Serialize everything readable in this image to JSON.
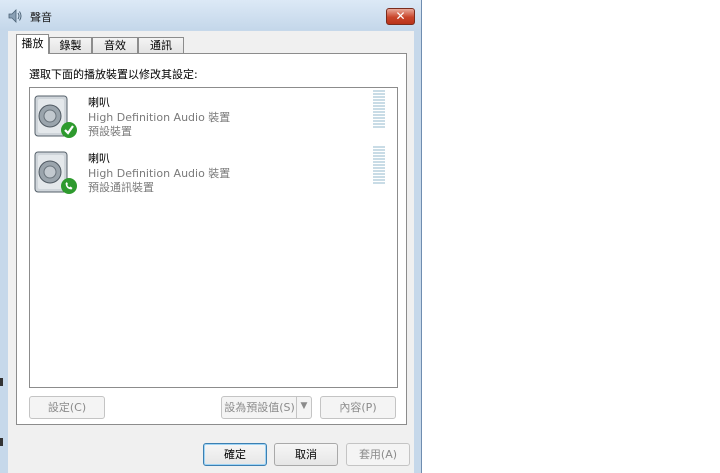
{
  "window": {
    "title": "聲音"
  },
  "tabs": [
    {
      "label": "播放",
      "active": true
    },
    {
      "label": "錄製",
      "active": false
    },
    {
      "label": "音效",
      "active": false
    },
    {
      "label": "通訊",
      "active": false
    }
  ],
  "panel": {
    "instruction": "選取下面的播放裝置以修改其設定:",
    "devices": [
      {
        "name": "喇叭",
        "description": "High Definition Audio 裝置",
        "status": "預設裝置",
        "badge_icon": "green-check-icon"
      },
      {
        "name": "喇叭",
        "description": "High Definition Audio 裝置",
        "status": "預設通訊裝置",
        "badge_icon": "green-phone-icon"
      }
    ],
    "configure_label": "設定(C)",
    "set_default_label": "設為預設值(S)",
    "properties_label": "內容(P)"
  },
  "footer": {
    "ok_label": "確定",
    "cancel_label": "取消",
    "apply_label": "套用(A)"
  },
  "colors": {
    "frame": "#c6d8ea",
    "close": "#c9452b",
    "meter": "#c9dce6",
    "badge_green": "#2e9a2e"
  }
}
